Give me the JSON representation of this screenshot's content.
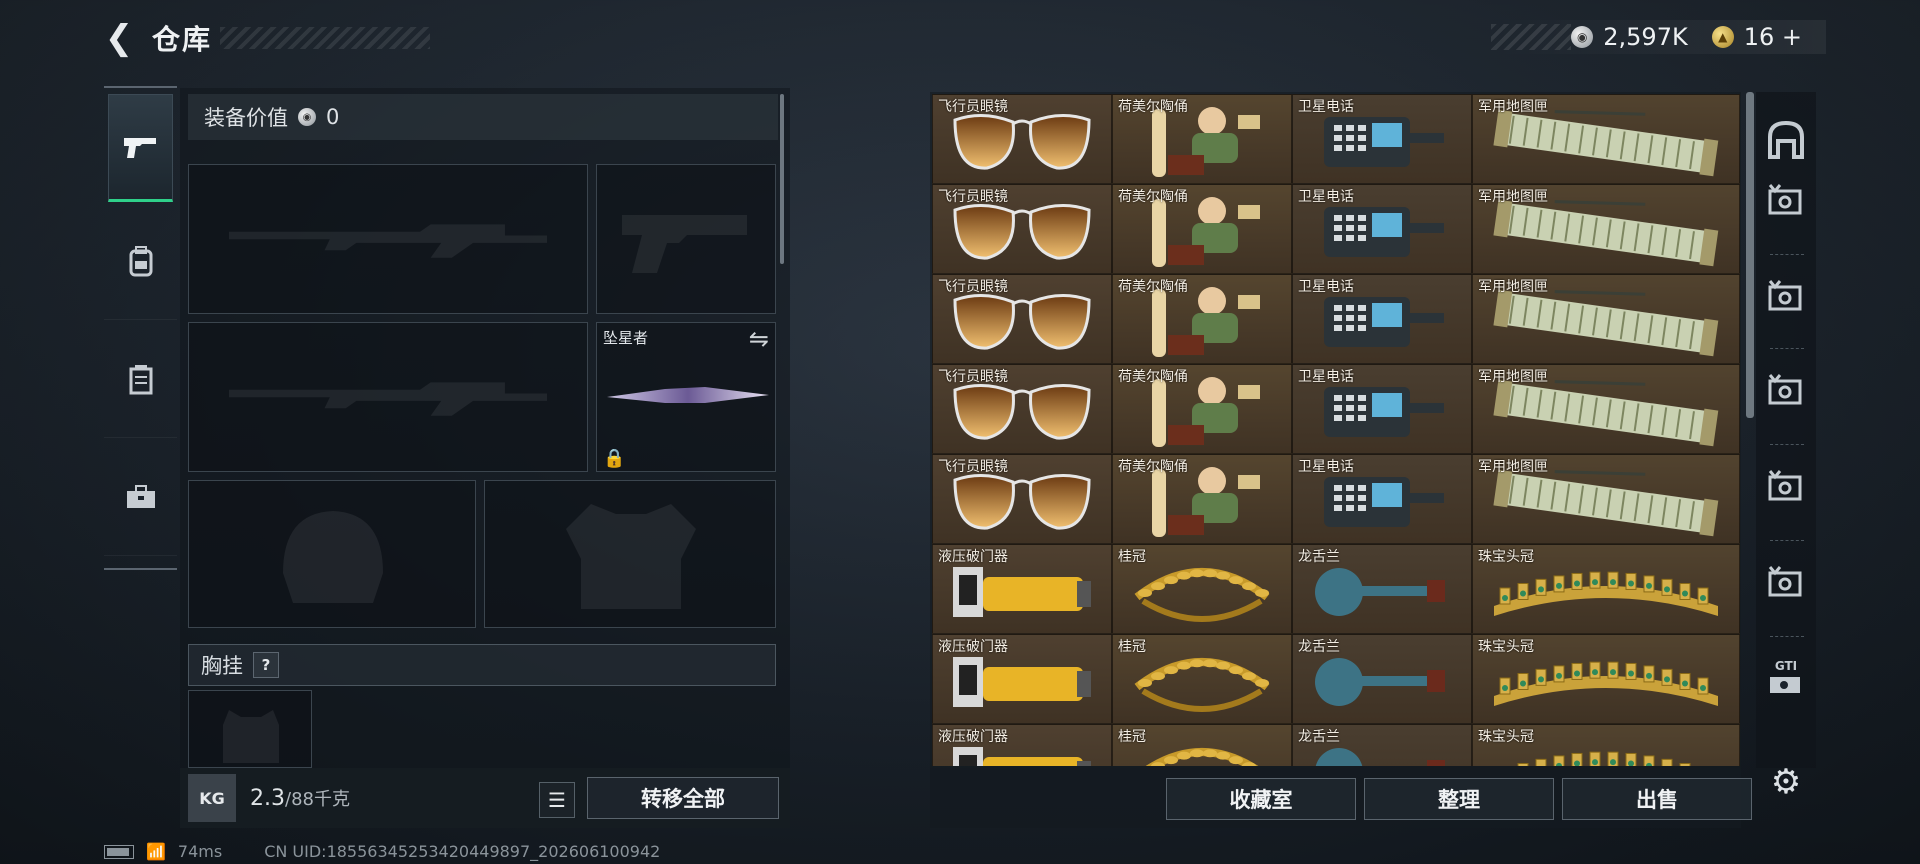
{
  "header": {
    "back_icon": "back-arrow-icon",
    "title": "仓库"
  },
  "currency": {
    "silver_value": "2,597K",
    "gold_value": "16",
    "gold_plus": "+"
  },
  "categories": [
    {
      "icon": "pistol-icon",
      "glyph": "▬",
      "active": true
    },
    {
      "icon": "backpack-icon",
      "glyph": "⛁",
      "active": false
    },
    {
      "icon": "vest-icon",
      "glyph": "▤",
      "active": false
    },
    {
      "icon": "briefcase-icon",
      "glyph": "💼",
      "active": false
    }
  ],
  "equipment": {
    "value_label": "装备价值",
    "value": "0",
    "knife_name": "坠星者",
    "chest_rig_label": "胸挂",
    "help": "?"
  },
  "footer_left": {
    "weight_icon_text": "KG",
    "weight_current": "2.3",
    "weight_max": "/88千克",
    "transfer_all": "转移全部"
  },
  "storage": {
    "rows": [
      [
        "飞行员眼镜",
        "荷美尔陶俑",
        "卫星电话",
        "军用地图匣"
      ],
      [
        "飞行员眼镜",
        "荷美尔陶俑",
        "卫星电话",
        "军用地图匣"
      ],
      [
        "飞行员眼镜",
        "荷美尔陶俑",
        "卫星电话",
        "军用地图匣"
      ],
      [
        "飞行员眼镜",
        "荷美尔陶俑",
        "卫星电话",
        "军用地图匣"
      ],
      [
        "飞行员眼镜",
        "荷美尔陶俑",
        "卫星电话",
        "军用地图匣"
      ],
      [
        "液压破门器",
        "桂冠",
        "龙舌兰",
        "珠宝头冠"
      ],
      [
        "液压破门器",
        "桂冠",
        "龙舌兰",
        "珠宝头冠"
      ],
      [
        "液压破门器",
        "桂冠",
        "龙舌兰",
        "珠宝头冠"
      ]
    ],
    "buttons": {
      "collection": "收藏室",
      "sort": "整理",
      "sell": "出售"
    }
  },
  "right_rail": {
    "top_icon": "arch-icon",
    "item_icon": "sell-tag-icon",
    "gti_label": "GTI",
    "settings_icon": "gear-icon"
  },
  "status": {
    "ping": "74ms",
    "uid": "CN UID:1855634525342044989​7_202606100942"
  },
  "colors": {
    "accent_green": "#2fd08a",
    "cell_bg": "#5a4a38"
  }
}
